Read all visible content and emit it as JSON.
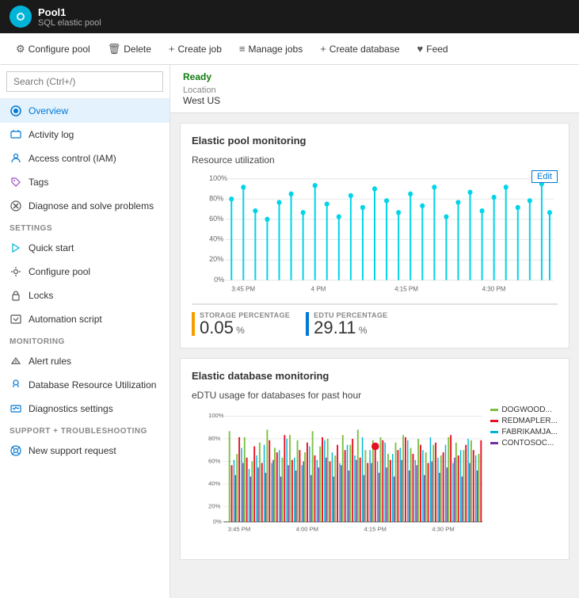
{
  "header": {
    "title": "Pool1",
    "subtitle": "SQL elastic pool",
    "icon_color": "#00b4d8"
  },
  "toolbar": {
    "buttons": [
      {
        "label": "Configure pool",
        "icon": "⚙"
      },
      {
        "label": "Delete",
        "icon": "🗑"
      },
      {
        "label": "Create job",
        "icon": "+"
      },
      {
        "label": "Manage jobs",
        "icon": "≡"
      },
      {
        "label": "Create database",
        "icon": "+"
      },
      {
        "label": "Feed",
        "icon": "♥"
      }
    ]
  },
  "sidebar": {
    "search_placeholder": "Search (Ctrl+/)",
    "items": [
      {
        "label": "Overview",
        "icon": "overview",
        "active": true,
        "section": null
      },
      {
        "label": "Activity log",
        "icon": "activity",
        "active": false,
        "section": null
      },
      {
        "label": "Access control (IAM)",
        "icon": "iam",
        "active": false,
        "section": null
      },
      {
        "label": "Tags",
        "icon": "tags",
        "active": false,
        "section": null
      },
      {
        "label": "Diagnose and solve problems",
        "icon": "diagnose",
        "active": false,
        "section": null
      },
      {
        "label": "Quick start",
        "icon": "quickstart",
        "active": false,
        "section": "SETTINGS"
      },
      {
        "label": "Configure pool",
        "icon": "configure",
        "active": false,
        "section": null
      },
      {
        "label": "Locks",
        "icon": "locks",
        "active": false,
        "section": null
      },
      {
        "label": "Automation script",
        "icon": "automation",
        "active": false,
        "section": null
      },
      {
        "label": "Alert rules",
        "icon": "alert",
        "active": false,
        "section": "MONITORING"
      },
      {
        "label": "Database Resource Utilization",
        "icon": "db-resource",
        "active": false,
        "section": null
      },
      {
        "label": "Diagnostics settings",
        "icon": "diagnostics",
        "active": false,
        "section": null
      },
      {
        "label": "New support request",
        "icon": "support",
        "active": false,
        "section": "SUPPORT + TROUBLESHOOTING"
      }
    ]
  },
  "content": {
    "status": "Ready",
    "location_label": "Location",
    "location_value": "West US",
    "resource_card": {
      "title": "Elastic pool monitoring",
      "subtitle": "Resource utilization",
      "edit_label": "Edit",
      "x_labels": [
        "3:45 PM",
        "4 PM",
        "4:15 PM",
        "4:30 PM"
      ],
      "y_labels": [
        "100%",
        "80%",
        "60%",
        "40%",
        "20%",
        "0%"
      ],
      "metrics": [
        {
          "label": "STORAGE PERCENTAGE",
          "value": "0.05",
          "unit": "%",
          "color": "orange"
        },
        {
          "label": "EDTU PERCENTAGE",
          "value": "29.11",
          "unit": "%",
          "color": "blue"
        }
      ]
    },
    "edtu_card": {
      "title": "Elastic database monitoring",
      "subtitle": "eDTU usage for databases for past hour",
      "x_labels": [
        "3:45 PM",
        "4:00 PM",
        "4:15 PM",
        "4:30 PM"
      ],
      "y_labels": [
        "100%",
        "80%",
        "60%",
        "40%",
        "20%",
        "0%"
      ],
      "legend": [
        {
          "label": "DOGWOOD...",
          "color": "#7dc143"
        },
        {
          "label": "REDMAPLER...",
          "color": "#e81123"
        },
        {
          "label": "FABRIKAMJA...",
          "color": "#00b4d8"
        },
        {
          "label": "CONTOSOC...",
          "color": "#7030a0"
        }
      ]
    }
  }
}
